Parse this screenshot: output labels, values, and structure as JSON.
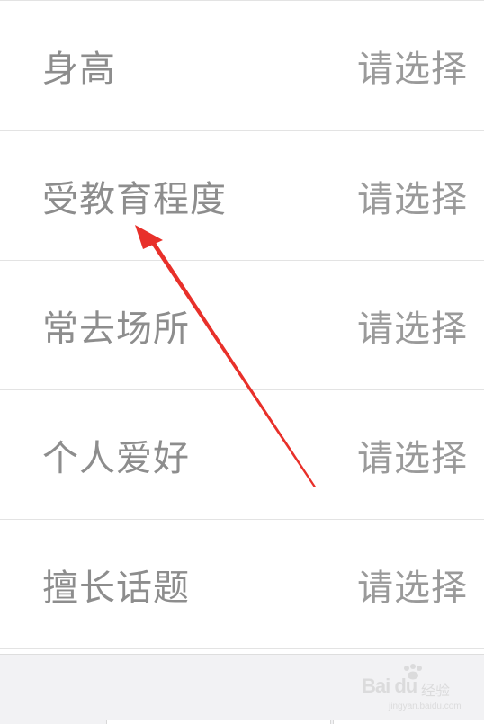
{
  "profile_fields": [
    {
      "label": "身高",
      "value": "请选择"
    },
    {
      "label": "受教育程度",
      "value": "请选择"
    },
    {
      "label": "常去场所",
      "value": "请选择"
    },
    {
      "label": "个人爱好",
      "value": "请选择"
    },
    {
      "label": "擅长话题",
      "value": "请选择"
    }
  ],
  "watermark": {
    "logo": "Bai du",
    "brand_cn": "经验",
    "url": "jingyan.baidu.com"
  },
  "colors": {
    "label_text": "#8d8d8d",
    "value_text": "#9a9a9a",
    "divider": "#e3e3e3",
    "footer_bg": "#f2f2f4",
    "annotation_arrow": "#e8302a"
  },
  "icons": [
    "annotation-arrow-icon",
    "baidu-paw-icon"
  ]
}
